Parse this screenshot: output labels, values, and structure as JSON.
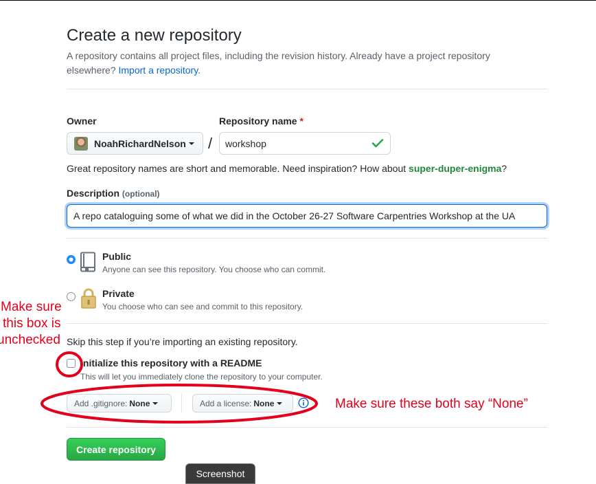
{
  "header": {
    "title": "Create a new repository",
    "subtitle": "A repository contains all project files, including the revision history. Already have a project repository elsewhere?",
    "import_link": "Import a repository",
    "subtitle_end": "."
  },
  "owner": {
    "label": "Owner",
    "value": "NoahRichardNelson"
  },
  "repo_name": {
    "label": "Repository name",
    "required_mark": "*",
    "value": "workshop",
    "slash": "/"
  },
  "hint": {
    "text": "Great repository names are short and memorable. Need inspiration? How about",
    "suggestion": "super-duper-enigma",
    "end": "?"
  },
  "description": {
    "label": "Description",
    "optional": "(optional)",
    "value": "A repo cataloguing some of what we did in the October 26-27 Software Carpentries Workshop at the UA"
  },
  "visibility": {
    "public": {
      "title": "Public",
      "desc": "Anyone can see this repository. You choose who can commit.",
      "selected": true
    },
    "private": {
      "title": "Private",
      "desc": "You choose who can see and commit to this repository.",
      "selected": false
    }
  },
  "init": {
    "skip_text": "Skip this step if you’re importing an existing repository.",
    "readme_label": "Initialize this repository with a README",
    "readme_desc": "This will let you immediately clone the repository to your computer.",
    "readme_checked": false
  },
  "selects": {
    "gitignore_label": "Add .gitignore:",
    "gitignore_value": "None",
    "license_label": "Add a license:",
    "license_value": "None"
  },
  "submit": {
    "label": "Create repository"
  },
  "screenshot_tab": {
    "label": "Screenshot"
  },
  "annotations": {
    "checkbox_note_1": "Make sure",
    "checkbox_note_2": "this box is",
    "checkbox_note_3": "unchecked",
    "selects_note": "Make sure these both say “None”"
  },
  "colors": {
    "accent_blue": "#0366d6",
    "success_green": "#28a745",
    "annotation_red": "#e3001b"
  }
}
